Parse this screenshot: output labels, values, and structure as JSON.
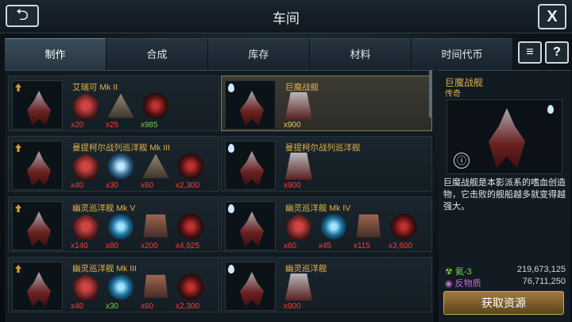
{
  "header": {
    "title": "车间",
    "back": "⮌",
    "close": "X"
  },
  "tabs": [
    {
      "label": "制作"
    },
    {
      "label": "合成"
    },
    {
      "label": "库存"
    },
    {
      "label": "材料"
    },
    {
      "label": "时间代币"
    }
  ],
  "icons": {
    "filter": "≡",
    "help": "?"
  },
  "cards": [
    {
      "name": "艾瑞可 Mk II",
      "mats": [
        {
          "v": "x20",
          "c": "red",
          "icon": "hull-material-icon"
        },
        {
          "v": "x25",
          "c": "red",
          "icon": "triangle-material-icon"
        },
        {
          "v": "x985",
          "c": "grn",
          "icon": "biohazard-material-icon"
        }
      ]
    },
    {
      "name": "巨魔战舰",
      "sel": true,
      "mats": [
        {
          "v": "x900",
          "c": "ylw",
          "icon": "blueprint-icon"
        }
      ]
    },
    {
      "name": "曼提柯尔战列巡洋舰 Mk III",
      "mats": [
        {
          "v": "x40",
          "c": "red",
          "icon": "hull-material-icon"
        },
        {
          "v": "x30",
          "c": "red",
          "icon": "shield-triangle-material-icon"
        },
        {
          "v": "x60",
          "c": "red",
          "icon": "triangle-material-icon"
        },
        {
          "v": "x2,300",
          "c": "red",
          "icon": "biohazard-material-icon"
        }
      ]
    },
    {
      "name": "曼提柯尔战列巡洋舰",
      "mats": [
        {
          "v": "x900",
          "c": "red",
          "icon": "blueprint-icon"
        }
      ]
    },
    {
      "name": "幽灵巡洋舰 Mk V",
      "mats": [
        {
          "v": "x140",
          "c": "red",
          "icon": "hull-material-icon"
        },
        {
          "v": "x80",
          "c": "red",
          "icon": "shield-material-icon"
        },
        {
          "v": "x200",
          "c": "red",
          "icon": "armor-material-icon"
        },
        {
          "v": "x4,925",
          "c": "red",
          "icon": "biohazard-material-icon"
        }
      ]
    },
    {
      "name": "幽灵巡洋舰 Mk IV",
      "mats": [
        {
          "v": "x60",
          "c": "red",
          "icon": "hull-material-icon"
        },
        {
          "v": "x45",
          "c": "red",
          "icon": "shield-material-icon"
        },
        {
          "v": "x115",
          "c": "red",
          "icon": "armor-material-icon"
        },
        {
          "v": "x3,600",
          "c": "red",
          "icon": "biohazard-material-icon"
        }
      ]
    },
    {
      "name": "幽灵巡洋舰 Mk III",
      "mats": [
        {
          "v": "x40",
          "c": "red",
          "icon": "hull-material-icon"
        },
        {
          "v": "x30",
          "c": "grn",
          "icon": "shield-material-icon"
        },
        {
          "v": "x60",
          "c": "red",
          "icon": "armor-material-icon"
        },
        {
          "v": "x2,300",
          "c": "red",
          "icon": "biohazard-material-icon"
        }
      ]
    },
    {
      "name": "幽灵巡洋舰",
      "mats": [
        {
          "v": "x900",
          "c": "red",
          "icon": "blueprint-icon"
        }
      ]
    }
  ],
  "detail": {
    "name": "巨魔战舰",
    "rarity": "传奇",
    "description": "巨魔战舰是本影派系的嗜血创造物，它击败的舰船越多就变得越强大。"
  },
  "resources": [
    {
      "name": "氦-3",
      "value": "219,673,125",
      "color": "#7fd24a"
    },
    {
      "name": "反物质",
      "value": "76,711,250",
      "color": "#c86bd6"
    }
  ],
  "get_button": "获取资源"
}
